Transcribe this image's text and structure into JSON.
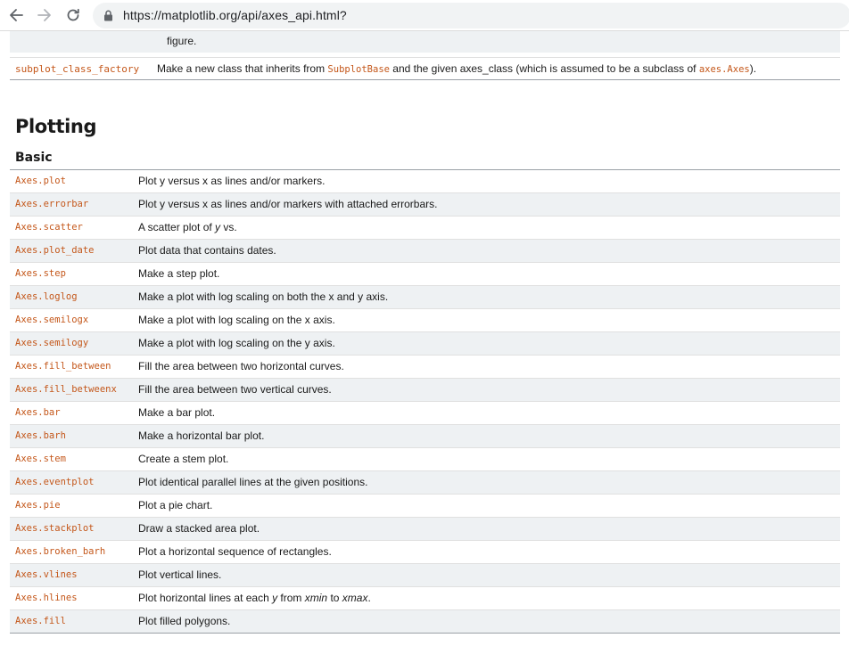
{
  "browser": {
    "url": "https://matplotlib.org/api/axes_api.html?",
    "back_icon": "arrow-left-icon",
    "forward_icon": "arrow-right-icon",
    "reload_icon": "reload-icon",
    "lock_icon": "lock-icon"
  },
  "top_fragment": {
    "text": "figure."
  },
  "factory_row": {
    "name": "subplot_class_factory",
    "desc_before": "Make a new class that inherits from ",
    "desc_code1": "SubplotBase",
    "desc_middle": " and the given axes_class (which is assumed to be a subclass of ",
    "desc_code2": "axes.Axes",
    "desc_after": ")."
  },
  "section": {
    "title": "Plotting",
    "subtitle": "Basic"
  },
  "rows": [
    {
      "name": "Axes.plot",
      "desc": "Plot y versus x as lines and/or markers."
    },
    {
      "name": "Axes.errorbar",
      "desc": "Plot y versus x as lines and/or markers with attached errorbars."
    },
    {
      "name": "Axes.scatter",
      "desc_pre": "A scatter plot of ",
      "desc_em": "y",
      "desc_post": " vs."
    },
    {
      "name": "Axes.plot_date",
      "desc": "Plot data that contains dates."
    },
    {
      "name": "Axes.step",
      "desc": "Make a step plot."
    },
    {
      "name": "Axes.loglog",
      "desc": "Make a plot with log scaling on both the x and y axis."
    },
    {
      "name": "Axes.semilogx",
      "desc": "Make a plot with log scaling on the x axis."
    },
    {
      "name": "Axes.semilogy",
      "desc": "Make a plot with log scaling on the y axis."
    },
    {
      "name": "Axes.fill_between",
      "desc": "Fill the area between two horizontal curves."
    },
    {
      "name": "Axes.fill_betweenx",
      "desc": "Fill the area between two vertical curves."
    },
    {
      "name": "Axes.bar",
      "desc": "Make a bar plot."
    },
    {
      "name": "Axes.barh",
      "desc": "Make a horizontal bar plot."
    },
    {
      "name": "Axes.stem",
      "desc": "Create a stem plot."
    },
    {
      "name": "Axes.eventplot",
      "desc": "Plot identical parallel lines at the given positions."
    },
    {
      "name": "Axes.pie",
      "desc": "Plot a pie chart."
    },
    {
      "name": "Axes.stackplot",
      "desc": "Draw a stacked area plot."
    },
    {
      "name": "Axes.broken_barh",
      "desc": "Plot a horizontal sequence of rectangles."
    },
    {
      "name": "Axes.vlines",
      "desc": "Plot vertical lines."
    },
    {
      "name": "Axes.hlines",
      "desc_pre": "Plot horizontal lines at each ",
      "desc_em": "y",
      "desc_mid": " from ",
      "desc_em2": "xmin",
      "desc_mid2": " to ",
      "desc_em3": "xmax",
      "desc_post": "."
    },
    {
      "name": "Axes.fill",
      "desc": "Plot filled polygons."
    }
  ],
  "colors": {
    "link_code": "#c4571a",
    "row_alt": "#eef1f3"
  }
}
